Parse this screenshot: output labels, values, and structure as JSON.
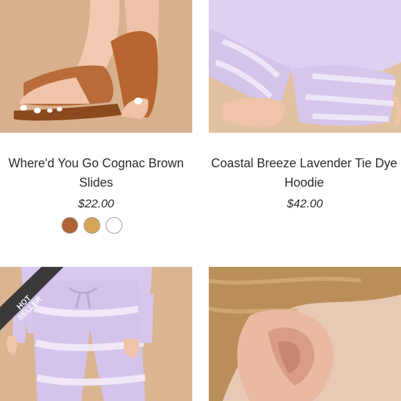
{
  "products": [
    {
      "title": "Where'd You Go Cognac Brown Slides",
      "price": "$22.00",
      "swatches": [
        "#b06234",
        "#d7a357",
        "#ffffff"
      ],
      "image_desc_icon": "sandal-photo-icon"
    },
    {
      "title": "Coastal Breeze Lavender Tie Dye Hoodie",
      "price": "$42.00",
      "image_desc_icon": "hoodie-photo-icon"
    },
    {
      "badge": [
        "HOT",
        "SELLER"
      ],
      "image_desc_icon": "joggers-photo-icon"
    },
    {
      "image_desc_icon": "earring-photo-icon"
    }
  ],
  "colors": {
    "text": "#2a2a2a",
    "badge_bg": "#3a3a3a",
    "lavender": "#d8c8ef"
  }
}
